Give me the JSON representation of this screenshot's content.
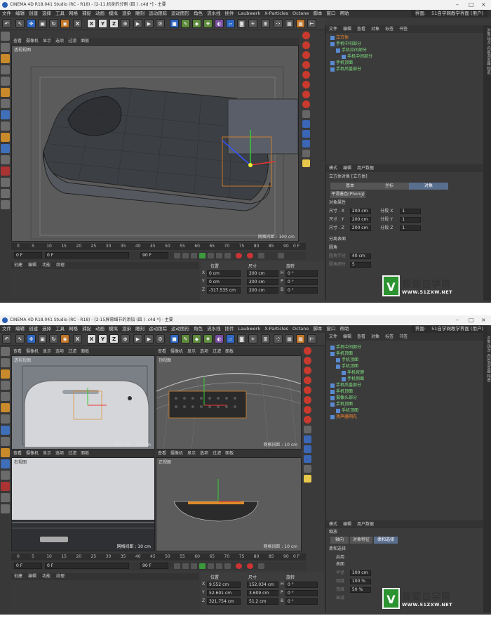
{
  "menus": [
    "文件",
    "编辑",
    "创建",
    "选择",
    "工具",
    "网格",
    "捕捉",
    "动画",
    "模拟",
    "渲染",
    "雕刻",
    "运动跟踪",
    "运动图形",
    "角色",
    "流水线",
    "插件",
    "Laubwerk",
    "X-Particles",
    "Octane",
    "脚本",
    "窗口",
    "帮助"
  ],
  "layout_label": "界面:",
  "layout_value": "51自学网教学界面 (用户)",
  "vp_menu": [
    "查看",
    "摄像机",
    "显示",
    "选项",
    "过滤",
    "面板"
  ],
  "win1": {
    "title": "CINEMA 4D R18.041 Studio (RC - R18) - [2-11.机身的分割 (四 ) .c4d *] - 主要",
    "vp_label": "透视视图",
    "grid": "网格间距 : 100 cm",
    "ticks": [
      "0",
      "5",
      "10",
      "15",
      "20",
      "25",
      "30",
      "35",
      "40",
      "45",
      "50",
      "55",
      "60",
      "65",
      "70",
      "75",
      "80",
      "85",
      "90"
    ],
    "frame_end": "0 F",
    "transport": {
      "start": "0 F",
      "cur": "0 F",
      "end": "90 F",
      "end2": "90 F"
    },
    "mat_menu": [
      "创建",
      "编辑",
      "功能",
      "纹理"
    ],
    "coords": {
      "headers": [
        "位置",
        "尺寸",
        "旋转"
      ],
      "rows": [
        {
          "axis": "X",
          "pos": "0 cm",
          "size": "200 cm",
          "rot_axis": "H",
          "rot": "0 °"
        },
        {
          "axis": "Y",
          "pos": "0 cm",
          "size": "200 cm",
          "rot_axis": "P",
          "rot": "0 °"
        },
        {
          "axis": "Z",
          "pos": "-317.535 cm",
          "size": "200 cm",
          "rot_axis": "B",
          "rot": "0 °"
        }
      ]
    },
    "obj_menu": [
      "文件",
      "编辑",
      "查看",
      "对象",
      "标签",
      "书签"
    ],
    "objects": [
      "立方体",
      "手机中间部分",
      "手机中间部分",
      "手机中间部分",
      "手机顶面",
      "手机后盖部分"
    ],
    "attr_menu": [
      "模式",
      "编辑",
      "用户数据"
    ],
    "attr_title": "立方体对象 [立方体]",
    "attr_tabs": [
      "基本",
      "坐标",
      "对象"
    ],
    "phong": "平滑着色(Phong)",
    "section": "对象属性",
    "props": [
      {
        "label": "尺寸 . X",
        "value": "200 cm",
        "seg": "分段 X",
        "segv": "1"
      },
      {
        "label": "尺寸 . Y",
        "value": "200 cm",
        "seg": "分段 Y",
        "segv": "1"
      },
      {
        "label": "尺寸 . Z",
        "value": "200 cm",
        "seg": "分段 Z",
        "segv": "1"
      }
    ],
    "extra": [
      "分离表面",
      "圆角",
      "圆角半径",
      "圆角细分"
    ],
    "extra_vals": [
      "",
      "",
      "40 cm",
      "5"
    ]
  },
  "win2": {
    "title": "CINEMA 4D R18.041 Studio (RC - R18) - [2-15屏幕细节的添加 (四 ) .c4d *] - 主要",
    "vp_labels": [
      "透视视图",
      "顶视图",
      "右视图",
      "正视图"
    ],
    "grids": [
      "网格间距 : 100 cm",
      "网格间距 : 10 cm",
      "网格间距 : 10 cm",
      "网格间距 : 10 cm"
    ],
    "ticks": [
      "0",
      "5",
      "10",
      "15",
      "20",
      "25",
      "30",
      "35",
      "40",
      "45",
      "50",
      "55",
      "60",
      "65",
      "70",
      "75",
      "80",
      "85",
      "90"
    ],
    "frame_end": "0 F",
    "transport": {
      "start": "0 F",
      "cur": "0 F",
      "end": "90 F",
      "end2": "90 F"
    },
    "coords": {
      "headers": [
        "位置",
        "尺寸",
        "旋转"
      ],
      "rows": [
        {
          "axis": "X",
          "pos": "9.552 cm",
          "size": "152.034 cm",
          "rot_axis": "H",
          "rot": "0 °"
        },
        {
          "axis": "Y",
          "pos": "52.601 cm",
          "size": "3.609 cm",
          "rot_axis": "P",
          "rot": "0 °"
        },
        {
          "axis": "Z",
          "pos": "321.754 cm",
          "size": "51.2 cm",
          "rot_axis": "B",
          "rot": "0 °"
        }
      ]
    },
    "objects": [
      "手机中间部分",
      "手机顶面",
      "手机顶面",
      "手机顶面",
      "手机按键",
      "手机侧面",
      "手机后盖部分",
      "手机顶面",
      "摄像头部分",
      "手机顶面",
      "手机顶面",
      "扬声器网孔"
    ],
    "attr_title": "缩放",
    "attr_tabs": [
      "轴向",
      "对象特征",
      "柔和选择"
    ],
    "section": "柔和选择",
    "props": [
      "启用",
      "表面",
      "半径",
      "强度",
      "宽度",
      "衰减"
    ],
    "prop_vals": [
      "",
      "",
      "100 cm",
      "100 %",
      "50 %",
      ""
    ]
  },
  "watermark": {
    "cn": "我要自学网",
    "url": "WWW.51ZXW.NET",
    "v": "V"
  },
  "side_tabs": [
    "对象",
    "场次",
    "内容浏览器",
    "构造"
  ]
}
